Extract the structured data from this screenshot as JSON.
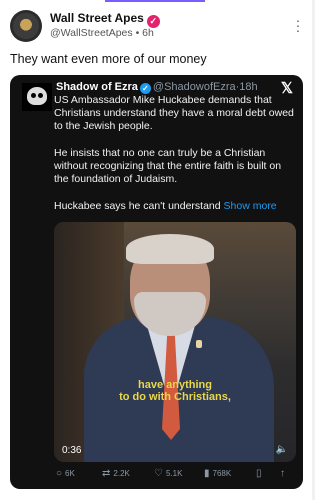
{
  "post": {
    "author_name": "Wall Street Apes",
    "handle": "@WallStreetApes",
    "separator": "•",
    "time": "6h",
    "text": "They want even more of our money"
  },
  "quote": {
    "author_name": "Shadow of Ezra",
    "handle": "@ShadowofEzra",
    "separator": "·",
    "time": "18h",
    "paragraphs": [
      "US Ambassador Mike Huckabee demands that Christians understand they have a moral debt owed to the Jewish people.",
      "He insists that no one can truly be a Christian without recognizing that the entire faith is built on the foundation of Judaism.",
      "Huckabee says he can't understand"
    ],
    "show_more_label": "Show more",
    "video": {
      "caption_line1": "have anything",
      "caption_line2": "to do with Christians,",
      "duration": "0:36"
    },
    "actions": {
      "replies": "6K",
      "reposts": "2.2K",
      "likes": "5.1K",
      "views": "768K"
    }
  },
  "icons": {
    "verified_color": "#e0246e",
    "quote_verified_color": "#1d9bf0",
    "accent_link": "#1d9bf0"
  }
}
